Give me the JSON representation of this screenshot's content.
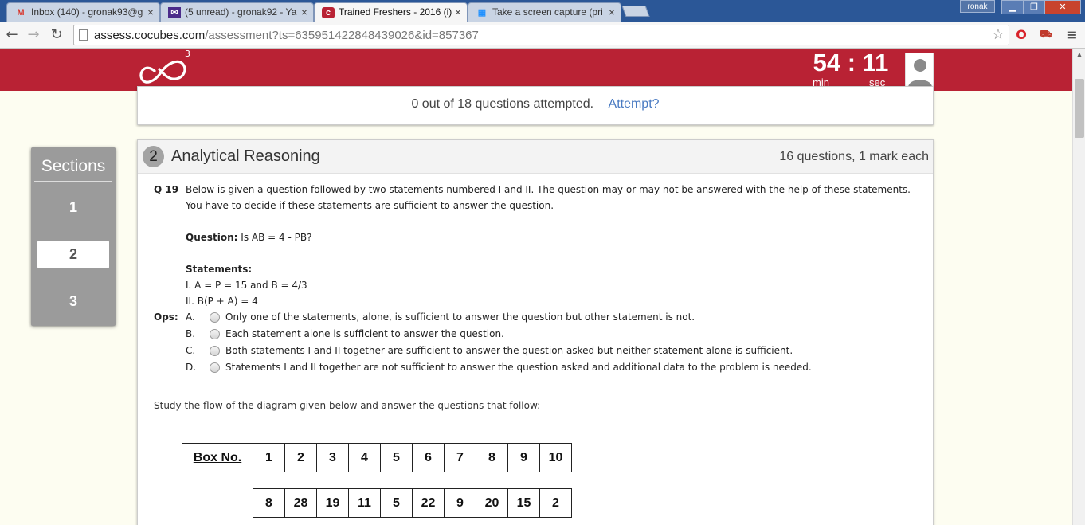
{
  "browser": {
    "tabs": [
      {
        "label": "Inbox (140) - gronak93@g",
        "icon": "gmail-icon",
        "active": false
      },
      {
        "label": "(5 unread) - gronak92 - Ya",
        "icon": "yahoo-mail-icon",
        "active": false
      },
      {
        "label": "Trained Freshers - 2016 (i)",
        "icon": "cocubes-icon",
        "active": true
      },
      {
        "label": "Take a screen capture (pri",
        "icon": "windows-icon",
        "active": false
      }
    ],
    "window_user": "ronak",
    "url_host": "assess.cocubes.com",
    "url_path": "/assessment?ts=635951422848439026&id=857367"
  },
  "header": {
    "logo_sup": "3",
    "timer_digits": "54 : 11",
    "timer_min_label": "min",
    "timer_sec_label": "sec"
  },
  "attempt": {
    "status": "0 out of 18 questions attempted.",
    "link": "Attempt?"
  },
  "sections": {
    "title": "Sections",
    "items": [
      "1",
      "2",
      "3"
    ],
    "active_index": 1
  },
  "section_header": {
    "number": "2",
    "name": "Analytical Reasoning",
    "info": "16 questions, 1 mark each"
  },
  "question": {
    "number": "Q 19",
    "text": "Below is given a question followed by two statements numbered I and II. The question may or may not be answered with the help of these statements. You have to decide if these statements are sufficient to answer the question.",
    "question_label": "Question:",
    "question_text": " Is AB = 4 - PB?",
    "statements_label": "Statements:",
    "statement_1": "I. A = P = 15 and B = 4/3",
    "statement_2": "II. B(P + A) = 4",
    "ops_label": "Ops:",
    "options": [
      {
        "letter": "A.",
        "text": "Only one of the statements, alone, is sufficient to answer the question but other statement is not."
      },
      {
        "letter": "B.",
        "text": "Each statement alone is sufficient to answer the question."
      },
      {
        "letter": "C.",
        "text": "Both statements I and II together are sufficient to answer the question asked but neither statement alone is sufficient."
      },
      {
        "letter": "D.",
        "text": "Statements I and II together are not sufficient to answer the question asked and additional data to the problem is needed."
      }
    ]
  },
  "study": {
    "text": "Study the flow of the diagram given below and answer the questions that follow:",
    "box_header": "Box No.",
    "box_numbers": [
      "1",
      "2",
      "3",
      "4",
      "5",
      "6",
      "7",
      "8",
      "9",
      "10"
    ],
    "box_values": [
      "8",
      "28",
      "19",
      "11",
      "5",
      "22",
      "9",
      "20",
      "15",
      "2"
    ]
  },
  "colors": {
    "header_red": "#b92234",
    "link_blue": "#4a7bc2",
    "sections_gray": "#9b9b9b",
    "page_bg": "#fdfdf1"
  }
}
